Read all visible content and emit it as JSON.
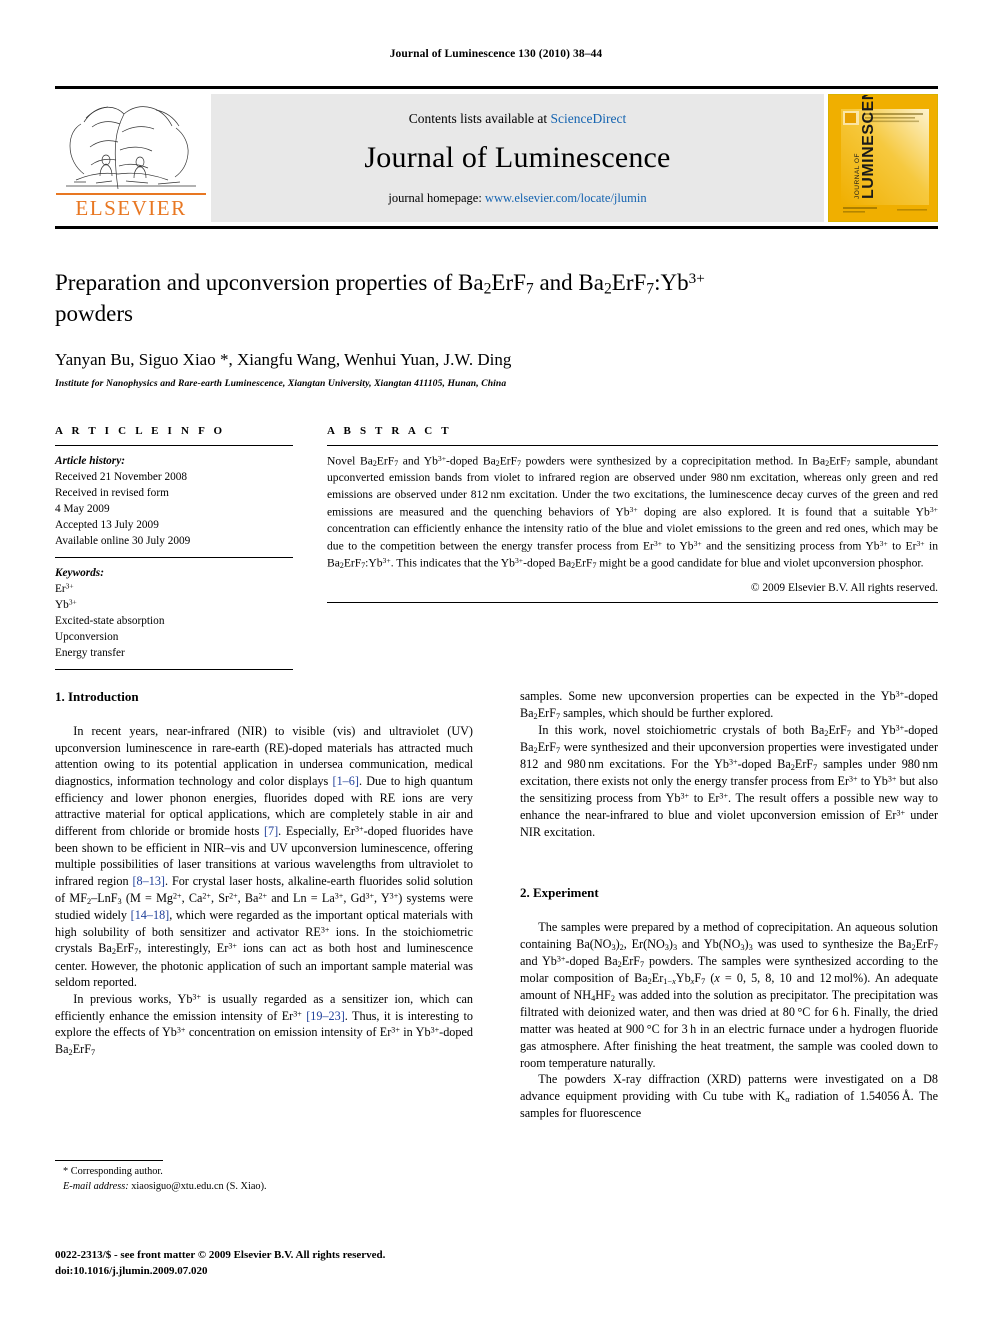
{
  "running_head": "Journal of Luminescence 130 (2010) 38–44",
  "masthead": {
    "contents_prefix": "Contents lists available at ",
    "sciencedirect": "ScienceDirect",
    "journal_name": "Journal of Luminescence",
    "homepage_prefix": "journal homepage: ",
    "homepage_url": "www.elsevier.com/locate/jlumin",
    "publisher_wordmark": "ELSEVIER",
    "cover_title_vertical": "LUMINESCENCE",
    "cover_title_small": "JOURNAL OF",
    "accent_orange": "#E87722",
    "cover_yellow": "#F0AF00",
    "link_blue": "#1463b0"
  },
  "title": {
    "line1_a": "Preparation and upconversion properties of Ba",
    "line1_sub1": "2",
    "line1_b": "ErF",
    "line1_sub2": "7",
    "line1_c": " and",
    "line2_a": "Ba",
    "line2_sub1": "2",
    "line2_b": "ErF",
    "line2_sub2": "7",
    "line2_c": ":Yb",
    "line2_sup": "3+",
    "line2_d": " powders"
  },
  "authors": "Yanyan Bu, Siguo Xiao *, Xiangfu Wang, Wenhui Yuan, J.W. Ding",
  "affiliation": "Institute for Nanophysics and Rare-earth Luminescence, Xiangtan University, Xiangtan 411105, Hunan, China",
  "article_info": {
    "heading": "A R T I C L E   I N F O",
    "history_label": "Article history:",
    "history": [
      "Received 21 November 2008",
      "Received in revised form",
      "4 May 2009",
      "Accepted 13 July 2009",
      "Available online 30 July 2009"
    ],
    "keywords_label": "Keywords:",
    "keywords": [
      "Er3+",
      "Yb3+",
      "Excited-state absorption",
      "Upconversion",
      "Energy transfer"
    ]
  },
  "abstract": {
    "heading": "A B S T R A C T",
    "text": "Novel Ba2ErF7 and Yb3+-doped Ba2ErF7 powders were synthesized by a coprecipitation method. In Ba2ErF7 sample, abundant upconverted emission bands from violet to infrared region are observed under 980 nm excitation, whereas only green and red emissions are observed under 812 nm excitation. Under the two excitations, the luminescence decay curves of the green and red emissions are measured and the quenching behaviors of Yb3+ doping are also explored. It is found that a suitable Yb3+ concentration can efficiently enhance the intensity ratio of the blue and violet emissions to the green and red ones, which may be due to the competition between the energy transfer process from Er3+ to Yb3+ and the sensitizing process from Yb3+ to Er3+ in Ba2ErF7:Yb3+. This indicates that the Yb3+-doped Ba2ErF7 might be a good candidate for blue and violet upconversion phosphor.",
    "copyright": "© 2009 Elsevier B.V. All rights reserved."
  },
  "sections": {
    "introduction_heading": "1.  Introduction",
    "experiment_heading": "2.  Experiment",
    "intro_p1": "In recent years, near-infrared (NIR) to visible (vis) and ultraviolet (UV) upconversion luminescence in rare-earth (RE)-doped materials has attracted much attention owing to its potential application in undersea communication, medical diagnostics, information technology and color displays [1–6]. Due to high quantum efficiency and lower phonon energies, fluorides doped with RE ions are very attractive material for optical applications, which are completely stable in air and different from chloride or bromide hosts [7]. Especially, Er3+-doped fluorides have been shown to be efficient in NIR–vis and UV upconversion luminescence, offering multiple possibilities of laser transitions at various wavelengths from ultraviolet to infrared region [8–13]. For crystal laser hosts, alkaline-earth fluorides solid solution of MF2–LnF3 (M = Mg2+, Ca2+, Sr2+, Ba2+ and Ln = La3+, Gd3+, Y3+) systems were studied widely [14–18], which were regarded as the important optical materials with high solubility of both sensitizer and activator RE3+ ions. In the stoichiometric crystals Ba2ErF7, interestingly, Er3+ ions can act as both host and luminescence center. However, the photonic application of such an important sample material was seldom reported.",
    "intro_p2": "In previous works, Yb3+ is usually regarded as a sensitizer ion, which can efficiently enhance the emission intensity of Er3+ [19–23]. Thus, it is interesting to explore the effects of Yb3+ concentration on emission intensity of Er3+ in Yb3+-doped Ba2ErF7 samples. Some new upconversion properties can be expected in the Yb3+-doped Ba2ErF7 samples, which should be further explored.",
    "intro_p3": "In this work, novel stoichiometric crystals of both Ba2ErF7 and Yb3+-doped Ba2ErF7 were synthesized and their upconversion properties were investigated under 812 and 980 nm excitations. For the Yb3+-doped Ba2ErF7 samples under 980 nm excitation, there exists not only the energy transfer process from Er3+ to Yb3+ but also the sensitizing process from Yb3+ to Er3+. The result offers a possible new way to enhance the near-infrared to blue and violet upconversion emission of Er3+ under NIR excitation.",
    "exp_p1": "The samples were prepared by a method of coprecipitation. An aqueous solution containing Ba(NO3)2, Er(NO3)3 and Yb(NO3)3 was used to synthesize the Ba2ErF7 and Yb3+-doped Ba2ErF7 powders. The samples were synthesized according to the molar composition of Ba2Er1−xYbxF7 (x = 0, 5, 8, 10 and 12 mol%). An adequate amount of NH4HF2 was added into the solution as precipitator. The precipitation was filtrated with deionized water, and then was dried at 80 °C for 6 h. Finally, the dried matter was heated at 900 °C for 3 h in an electric furnace under a hydrogen fluoride gas atmosphere. After finishing the heat treatment, the sample was cooled down to room temperature naturally.",
    "exp_p2": "The powders X-ray diffraction (XRD) patterns were investigated on a D8 advance equipment providing with Cu tube with Kα radiation of 1.54056 Å. The samples for fluorescence"
  },
  "footnote": {
    "corresponding": "* Corresponding author.",
    "email_label": "E-mail address:",
    "email": " xiaosiguo@xtu.edu.cn (S. Xiao)."
  },
  "footer": {
    "line1": "0022-2313/$ - see front matter © 2009 Elsevier B.V. All rights reserved.",
    "line2": "doi:10.1016/j.jlumin.2009.07.020"
  }
}
